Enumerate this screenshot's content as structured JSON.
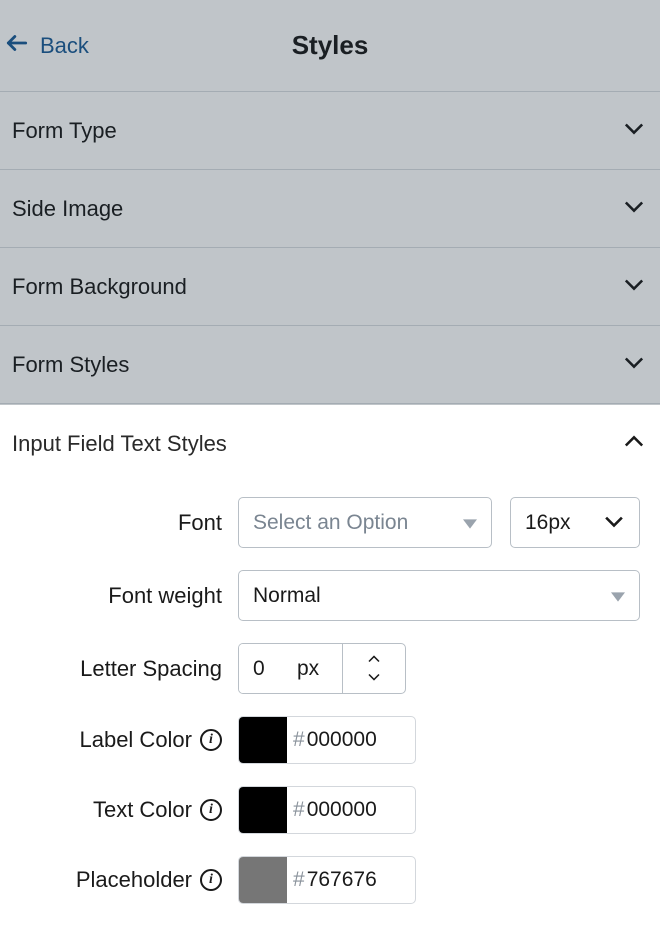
{
  "header": {
    "back_label": "Back",
    "title": "Styles"
  },
  "sections": {
    "form_type": "Form Type",
    "side_image": "Side Image",
    "form_background": "Form Background",
    "form_styles": "Form Styles"
  },
  "expanded": {
    "title": "Input Field Text Styles",
    "font": {
      "label": "Font",
      "placeholder": "Select an Option",
      "size": "16px"
    },
    "font_weight": {
      "label": "Font weight",
      "value": "Normal"
    },
    "letter_spacing": {
      "label": "Letter Spacing",
      "value": "0",
      "unit": "px"
    },
    "label_color": {
      "label": "Label Color",
      "hex": "000000",
      "swatch": "#000000"
    },
    "text_color": {
      "label": "Text Color",
      "hex": "000000",
      "swatch": "#000000"
    },
    "placeholder_color": {
      "label": "Placeholder",
      "hex": "767676",
      "swatch": "#767676"
    }
  }
}
